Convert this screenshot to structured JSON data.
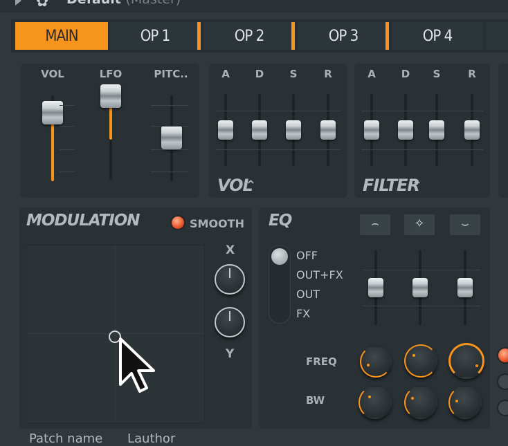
{
  "window": {
    "title": "Default",
    "subtitle": "(Master)"
  },
  "tabs": [
    {
      "label": "MAIN",
      "active": true
    },
    {
      "label": "OP 1"
    },
    {
      "label": "OP 2"
    },
    {
      "label": "OP 3"
    },
    {
      "label": "OP 4"
    }
  ],
  "master": {
    "labels": [
      "VOL",
      "LFO",
      "PITC.."
    ],
    "levels": [
      0.72,
      0.88,
      0.45
    ]
  },
  "vol_env": {
    "labels": [
      "A",
      "D",
      "S",
      "R"
    ],
    "title": "VOL"
  },
  "filter_env": {
    "labels": [
      "A",
      "D",
      "S",
      "R"
    ],
    "title": "FILTER"
  },
  "modulation": {
    "title": "MODULATION",
    "smooth_label": "SMOOTH",
    "x_label": "X",
    "y_label": "Y"
  },
  "eq": {
    "title": "EQ",
    "modes": [
      "OFF",
      "OUT+FX",
      "OUT",
      "FX"
    ],
    "freq_label": "FREQ",
    "bw_label": "BW",
    "freq_values": [
      0.15,
      0.4,
      0.7
    ],
    "bw_values": [
      0.25,
      0.2,
      0.2
    ]
  },
  "footer": {
    "patch_name": "Patch name",
    "author": "Lauthor"
  },
  "colors": {
    "accent": "#f7941d",
    "panel": "#2a3135",
    "background": "#31383c"
  }
}
